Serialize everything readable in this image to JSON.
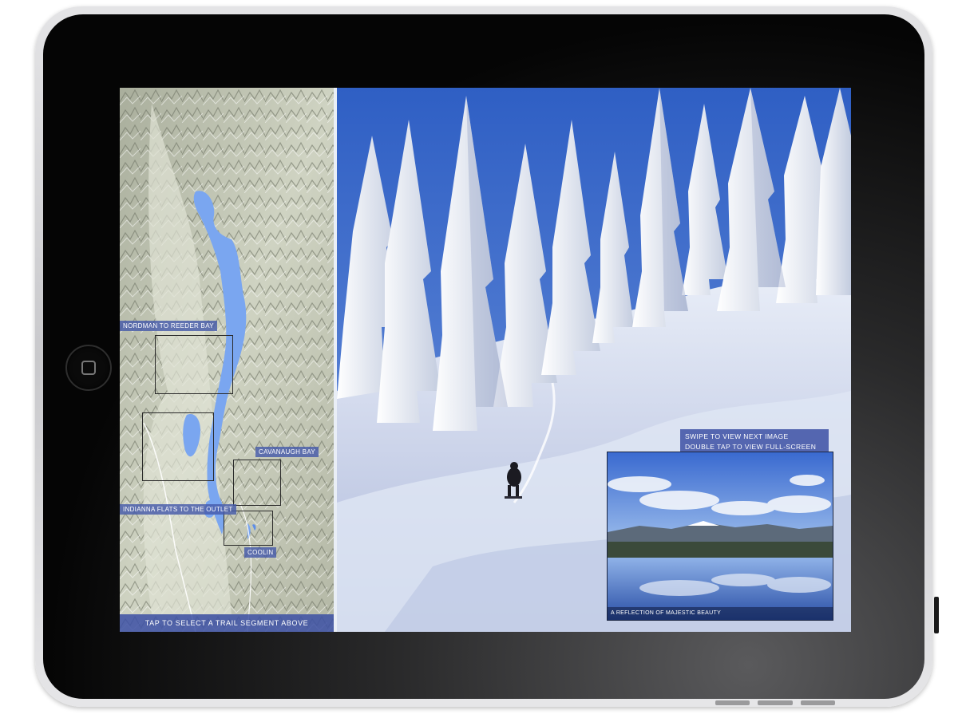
{
  "map": {
    "segments": [
      {
        "label": "NORDMAN TO REEDER BAY"
      },
      {
        "label": "CAVANAUGH BAY"
      },
      {
        "label": "INDIANNA FLATS TO THE OUTLET"
      },
      {
        "label": "COOLIN"
      }
    ],
    "footer": "TAP TO SELECT A TRAIL SEGMENT ABOVE"
  },
  "photo": {
    "instructions": [
      "SWIPE TO VIEW NEXT IMAGE",
      "DOUBLE TAP TO VIEW FULL-SCREEN"
    ],
    "thumbnail_caption": "A REFLECTION OF MAJESTIC BEAUTY"
  },
  "colors": {
    "label_bg": "#4a5aa8",
    "lake": "#7aa6f0",
    "sky": "#3a6ad0"
  },
  "icons": {
    "home_button": "home-square-icon"
  }
}
